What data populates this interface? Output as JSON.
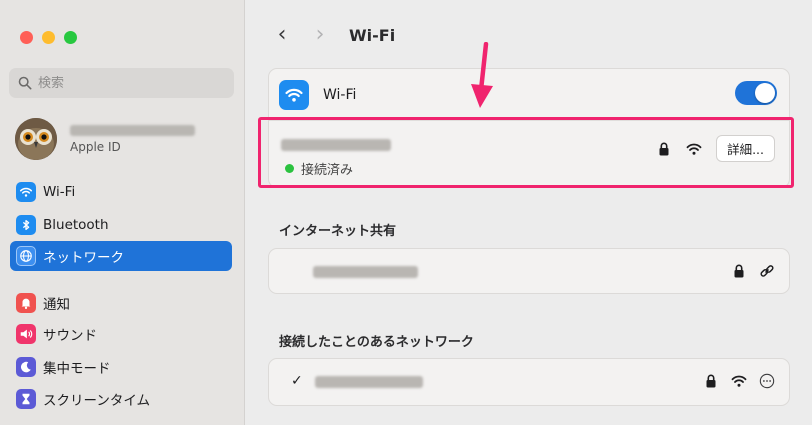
{
  "sidebar": {
    "search_placeholder": "検索",
    "account": {
      "subtitle": "Apple ID"
    },
    "items": [
      {
        "label": "Wi-Fi",
        "color": "#1e8cf0",
        "icon": "wifi-icon"
      },
      {
        "label": "Bluetooth",
        "color": "#1e8cf0",
        "icon": "bluetooth-icon"
      },
      {
        "label": "ネットワーク",
        "color": "#1e8cf0",
        "icon": "globe-icon",
        "active": true
      },
      {
        "label": "通知",
        "color": "#f0524f",
        "icon": "bell-icon"
      },
      {
        "label": "サウンド",
        "color": "#f0356b",
        "icon": "speaker-icon"
      },
      {
        "label": "集中モード",
        "color": "#5c5ad6",
        "icon": "moon-icon"
      },
      {
        "label": "スクリーンタイム",
        "color": "#5c5ad6",
        "icon": "hourglass-icon"
      }
    ]
  },
  "header": {
    "title": "Wi-Fi",
    "back": "‹",
    "forward": "›"
  },
  "wifi": {
    "label": "Wi-Fi",
    "enabled": true,
    "current_network": {
      "status": "接続済み",
      "details_button": "詳細..."
    }
  },
  "sections": {
    "sharing_title": "インターネット共有",
    "known_title": "接続したことのあるネットワーク"
  },
  "known_network": {
    "checkmark": "✓"
  },
  "colors": {
    "accent": "#1f73d8",
    "highlight": "#f0246e",
    "connected": "#2bc23f"
  }
}
